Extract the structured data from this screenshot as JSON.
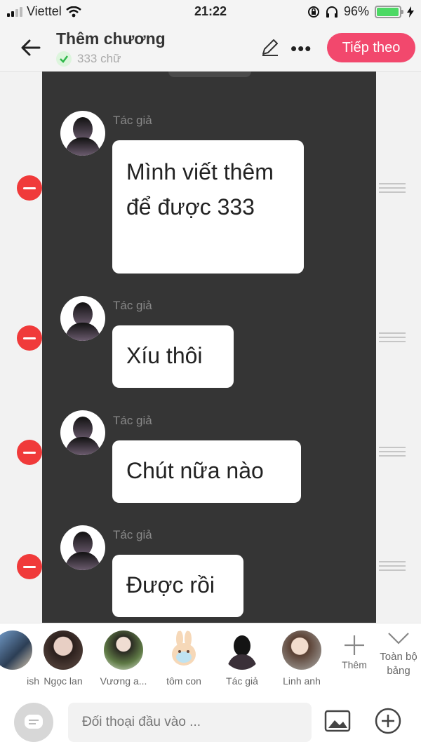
{
  "status": {
    "carrier": "Viettel",
    "time": "21:22",
    "battery": "96%",
    "battery_level": 0.96
  },
  "header": {
    "title": "Thêm chương",
    "word_count": "333 chữ",
    "next_label": "Tiếp theo"
  },
  "messages": [
    {
      "author": "Tác giả",
      "text": "Mình viết thêm để được 333"
    },
    {
      "author": "Tác giả",
      "text": "Xíu thôi"
    },
    {
      "author": "Tác giả",
      "text": "Chút nữa nào"
    },
    {
      "author": "Tác giả",
      "text": "Được rồi"
    }
  ],
  "characters": [
    {
      "name": "ish"
    },
    {
      "name": "Ngọc lan"
    },
    {
      "name": "Vương a..."
    },
    {
      "name": "tôm con"
    },
    {
      "name": "Tác giả"
    },
    {
      "name": "Linh anh"
    }
  ],
  "add_character_label": "Thêm",
  "toggle_label": "Toàn bộ bảng",
  "input": {
    "placeholder": "Đối thoại đầu vào ..."
  },
  "colors": {
    "accent": "#f2486d",
    "panel": "#353535",
    "remove": "#f03a3a"
  }
}
